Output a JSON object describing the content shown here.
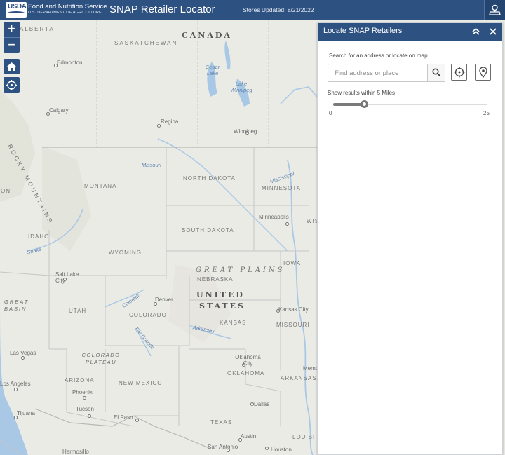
{
  "header": {
    "agency_name": "Food and Nutrition Service",
    "department": "U.S. DEPARTMENT OF AGRICULTURE",
    "logo_text": "USDA",
    "app_title": "SNAP Retailer Locator",
    "stores_updated": "Stores Updated: 8/21/2022",
    "tool_icon": "map-tool-icon"
  },
  "map_controls": {
    "zoom_in": "+",
    "zoom_out": "−",
    "home_icon": "home-icon",
    "locate_icon": "locate-icon"
  },
  "map_labels": {
    "countries": [
      "CANADA",
      "UNITED",
      "STATES"
    ],
    "regions": [
      "SASKATCHEWAN",
      "ALBERTA",
      "NORTH DAKOTA",
      "MINNESOTA",
      "MONTANA",
      "SOUTH DAKOTA",
      "IDAHO",
      "WYOMING",
      "NEBRASKA",
      "IOWA",
      "UTAH",
      "COLORADO",
      "KANSAS",
      "MISSOURI",
      "NEW MEXICO",
      "ARIZONA",
      "OKLAHOMA",
      "ARKANSAS",
      "TEXAS",
      "LOUISI",
      "ON",
      "WIS"
    ],
    "physical": [
      "GREAT PLAINS",
      "ROCKY MOUNTAINS",
      "GREAT BASIN",
      "COLORADO PLATEAU"
    ],
    "cities": [
      "Edmonton",
      "Calgary",
      "Regina",
      "Winnipeg",
      "Minneapolis",
      "Salt Lake City",
      "Denver",
      "Kansas City",
      "Las Vegas",
      "Los Angeles",
      "Phoenix",
      "Tucson",
      "Tijuana",
      "El Paso",
      "Oklahoma City",
      "Dallas",
      "Austin",
      "San Antonio",
      "Houston",
      "Hermosillo",
      "Memphis"
    ],
    "water": [
      "Cedar Lake",
      "Lake Winnipeg",
      "Missouri",
      "Mississippi",
      "Colorado",
      "Snake",
      "Arkansas",
      "Rio Grande"
    ]
  },
  "panel": {
    "title": "Locate SNAP Retailers",
    "collapse_icon": "chevron-double-up-icon",
    "close_icon": "close-icon",
    "search_label": "Search for an address or locate on map",
    "search_placeholder": "Find address or place",
    "search_icon": "search-icon",
    "locate_icon": "crosshair-icon",
    "pin_icon": "map-pin-icon",
    "radius_label": "Show results within 5 Miles",
    "radius_min": "0",
    "radius_max": "25",
    "radius_value": 5,
    "radius_max_value": 25
  },
  "colors": {
    "header": "#2d5180",
    "panel_header": "#2d5180",
    "map_land": "#ebebe6",
    "water": "#a9c8e6"
  }
}
